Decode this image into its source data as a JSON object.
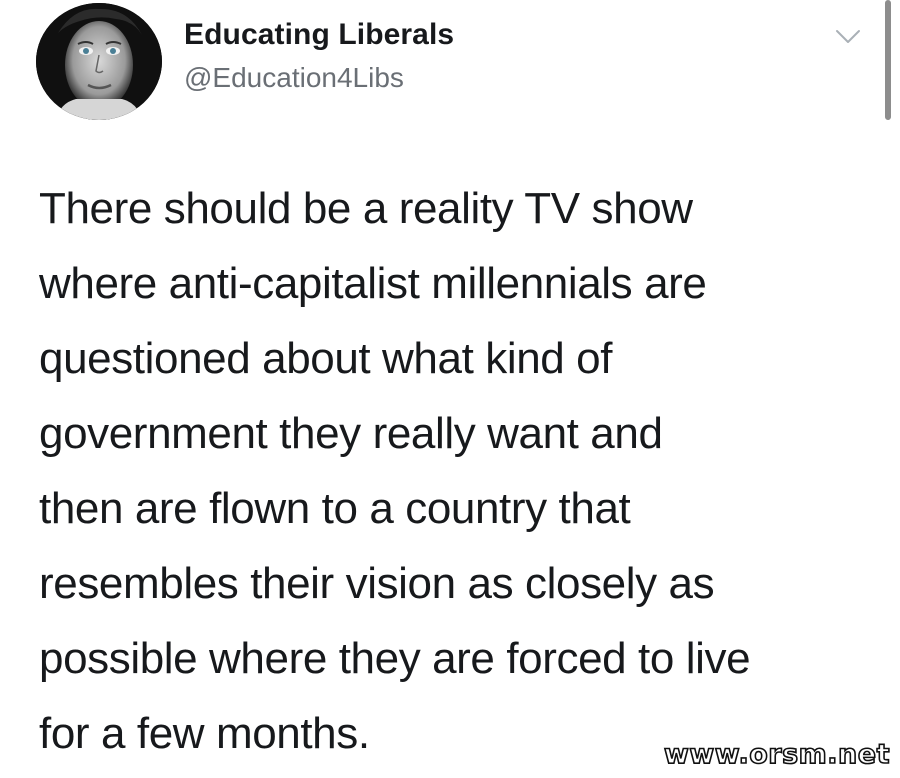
{
  "author": {
    "display_name": "Educating Liberals",
    "handle": "@Education4Libs",
    "avatar_icon": "profile-avatar"
  },
  "menu": {
    "icon": "chevron-down-icon"
  },
  "tweet": {
    "lines": [
      "There should be a reality TV show",
      "where anti-capitalist millennials are",
      "questioned about what kind of",
      "government they really want and",
      "then are flown to a country that",
      "resembles their vision as closely as",
      "possible where they are forced to live",
      "for a few months."
    ]
  },
  "watermark": {
    "text": "www.orsm.net"
  },
  "colors": {
    "text": "#17191c",
    "handle": "#6a6f75",
    "background": "#ffffff"
  }
}
